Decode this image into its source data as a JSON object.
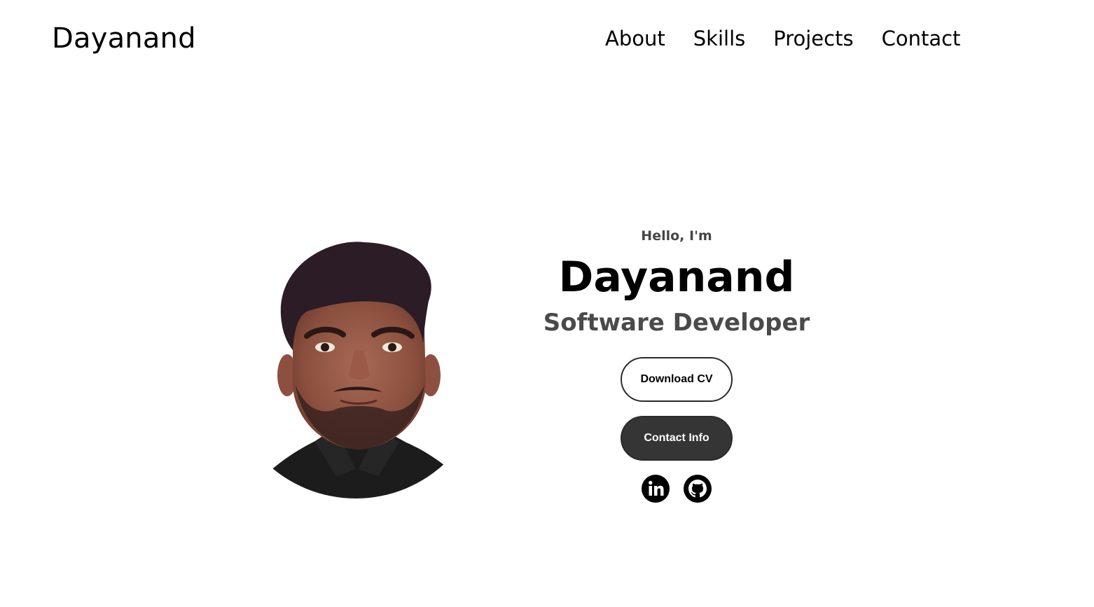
{
  "header": {
    "brand": "Dayanand",
    "nav": [
      {
        "label": "About"
      },
      {
        "label": "Skills"
      },
      {
        "label": "Projects"
      },
      {
        "label": "Contact"
      }
    ]
  },
  "hero": {
    "greeting": "Hello, I'm",
    "name": "Dayanand",
    "role": "Software Developer",
    "download_cv_label": "Download CV",
    "contact_info_label": "Contact Info",
    "socials": [
      {
        "icon": "linkedin-icon"
      },
      {
        "icon": "github-icon"
      }
    ]
  },
  "colors": {
    "text": "#000000",
    "muted_text": "#4a4a4a",
    "button_dark": "#353535",
    "background": "#ffffff"
  }
}
